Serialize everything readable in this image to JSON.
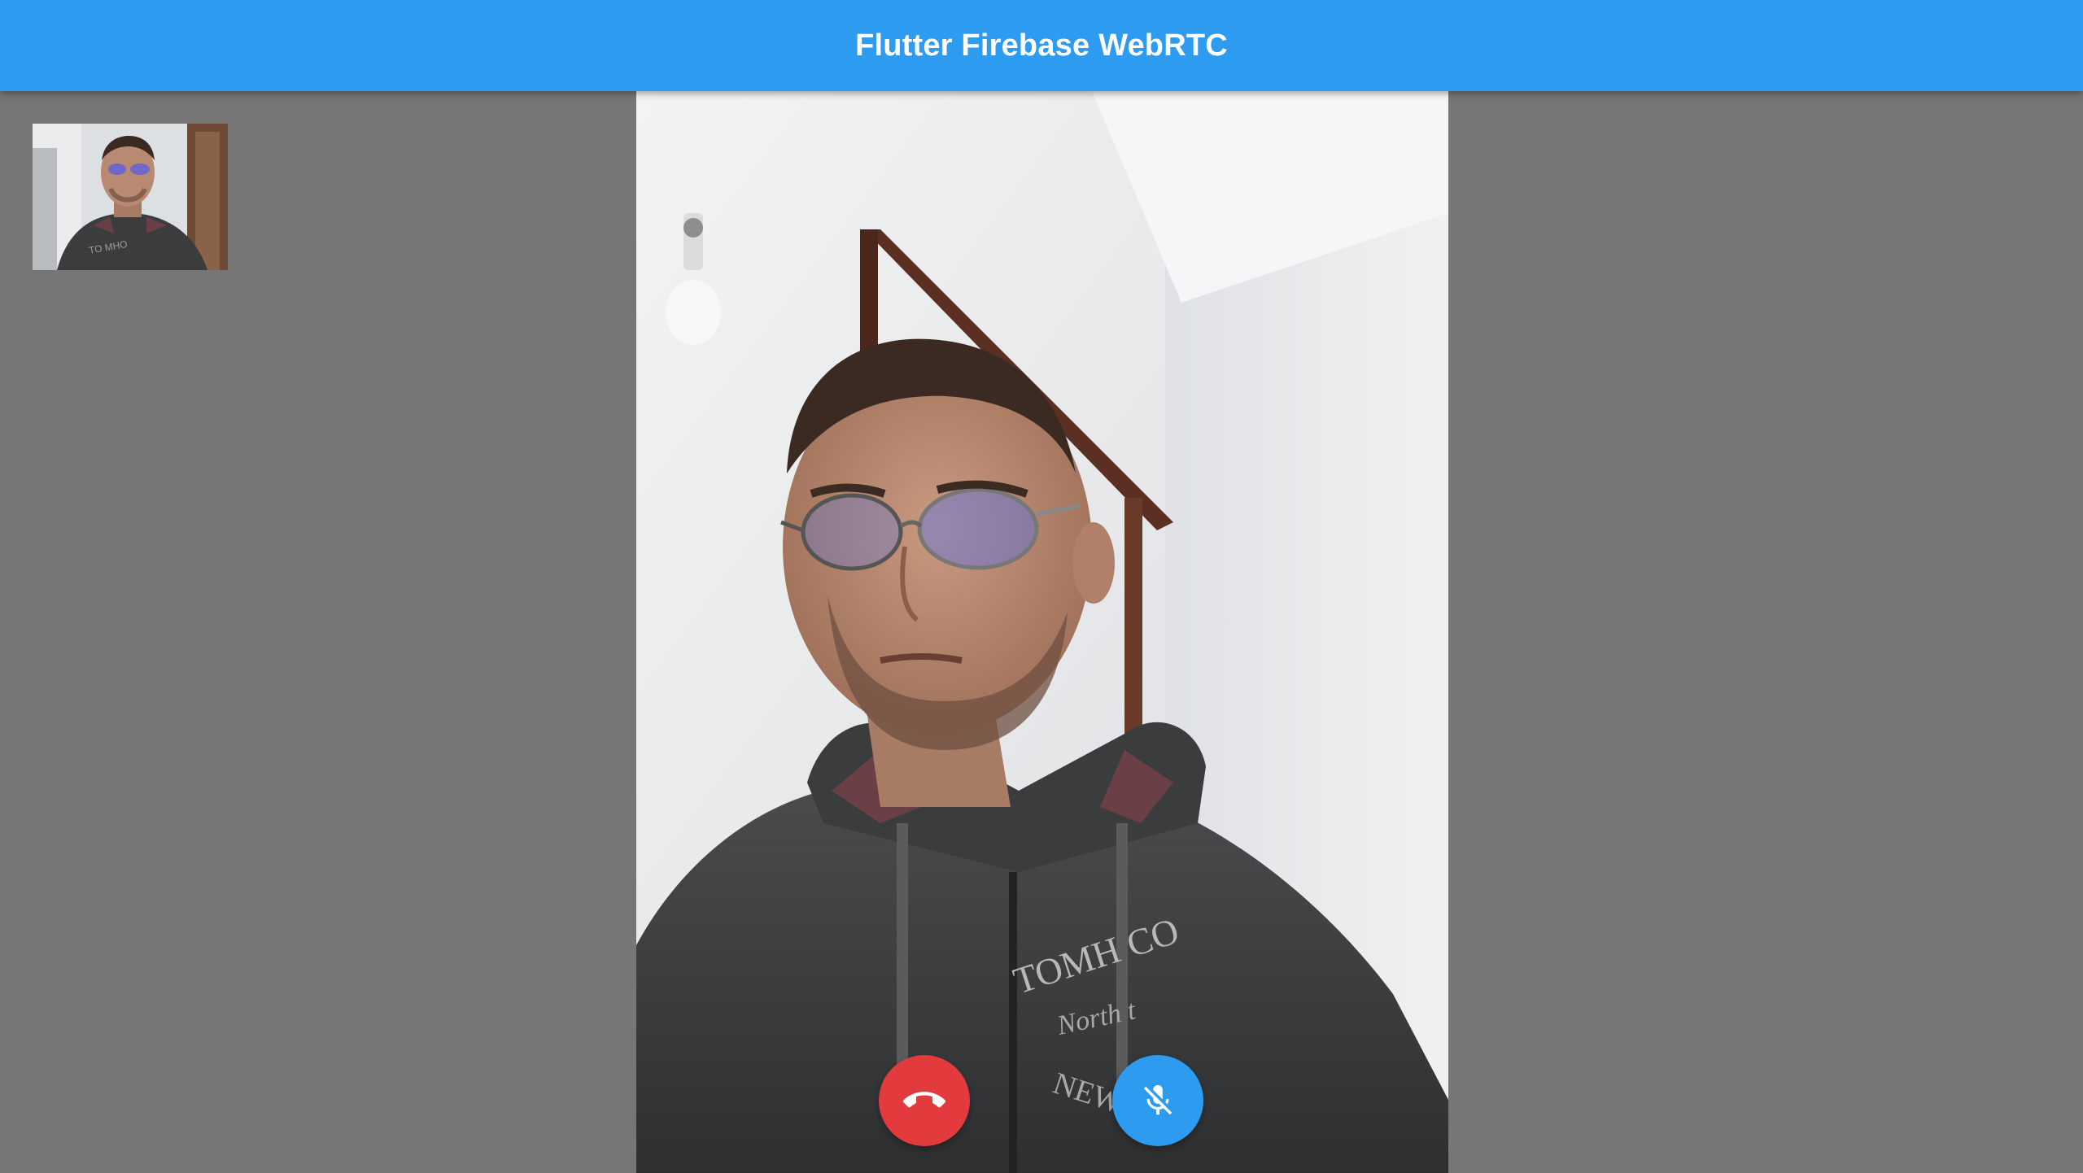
{
  "app_bar": {
    "title": "Flutter Firebase WebRTC"
  },
  "colors": {
    "app_bar": "#2d9bef",
    "background": "#767676",
    "hangup_button": "#e23a3d",
    "mute_button": "#2d9bef",
    "icon": "#ffffff"
  },
  "remote_video": {
    "icon": "video-feed"
  },
  "local_video": {
    "icon": "video-feed"
  },
  "controls": {
    "hangup_icon": "call-end-icon",
    "mute_icon": "mic-off-icon"
  }
}
